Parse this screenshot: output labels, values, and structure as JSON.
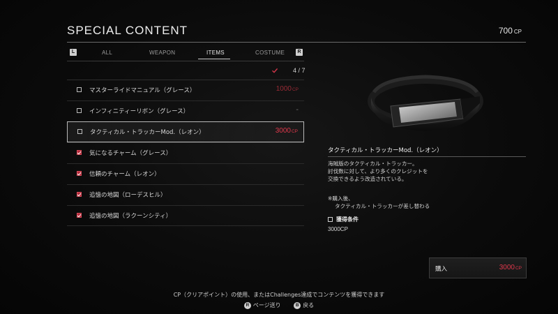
{
  "header": {
    "title": "SPECIAL CONTENT",
    "cp_amount": "700",
    "cp_unit": "CP"
  },
  "tabs": {
    "left_key": "L",
    "right_key": "R",
    "items": [
      {
        "label": "ALL",
        "active": false
      },
      {
        "label": "WEAPON",
        "active": false
      },
      {
        "label": "ITEMS",
        "active": true
      },
      {
        "label": "COSTUME",
        "active": false
      }
    ]
  },
  "progress": {
    "text": "4 / 7",
    "check_icon": "check-icon"
  },
  "items": [
    {
      "name": "マスターライドマニュアル（グレース）",
      "price": "1000",
      "unit": "CP",
      "owned": false,
      "selected": false
    },
    {
      "name": "インフィニティーリボン（グレース）",
      "price": "-",
      "unit": "",
      "owned": false,
      "selected": false
    },
    {
      "name": "タクティカル・トラッカーMod.（レオン）",
      "price": "3000",
      "unit": "CP",
      "owned": false,
      "selected": true
    },
    {
      "name": "気になるチャーム（グレース）",
      "price": "",
      "unit": "",
      "owned": true,
      "selected": false
    },
    {
      "name": "信頼のチャーム（レオン）",
      "price": "",
      "unit": "",
      "owned": true,
      "selected": false
    },
    {
      "name": "追憶の地図（ローデスヒル）",
      "price": "",
      "unit": "",
      "owned": true,
      "selected": false
    },
    {
      "name": "追憶の地図（ラクーンシティ）",
      "price": "",
      "unit": "",
      "owned": true,
      "selected": false
    }
  ],
  "detail": {
    "image": "tracker-bracelet-image",
    "name": "タクティカル・トラッカーMod.（レオン）",
    "description": [
      "海賊版のタクティカル・トラッカー。",
      "討伐数に対して、より多くのクレジットを",
      "交換できるよう改造されている。"
    ],
    "note": [
      "※購入後、",
      "タクティカル・トラッカーが差し替わる"
    ],
    "acquire_label": "獲得条件",
    "acquire_value": "3000CP"
  },
  "buy": {
    "label": "購入",
    "price": "3000",
    "unit": "CP"
  },
  "footer": {
    "info": "CP（クリアポイント）の使用、またはChallenges達成でコンテンツを獲得できます",
    "page_key": "R",
    "page_label": "ページ送り",
    "back_key": "B",
    "back_label": "戻る"
  },
  "colors": {
    "accent_red": "#e0384c",
    "dim_red": "#9a2b36",
    "checkbox_red": "#b62a3a"
  }
}
